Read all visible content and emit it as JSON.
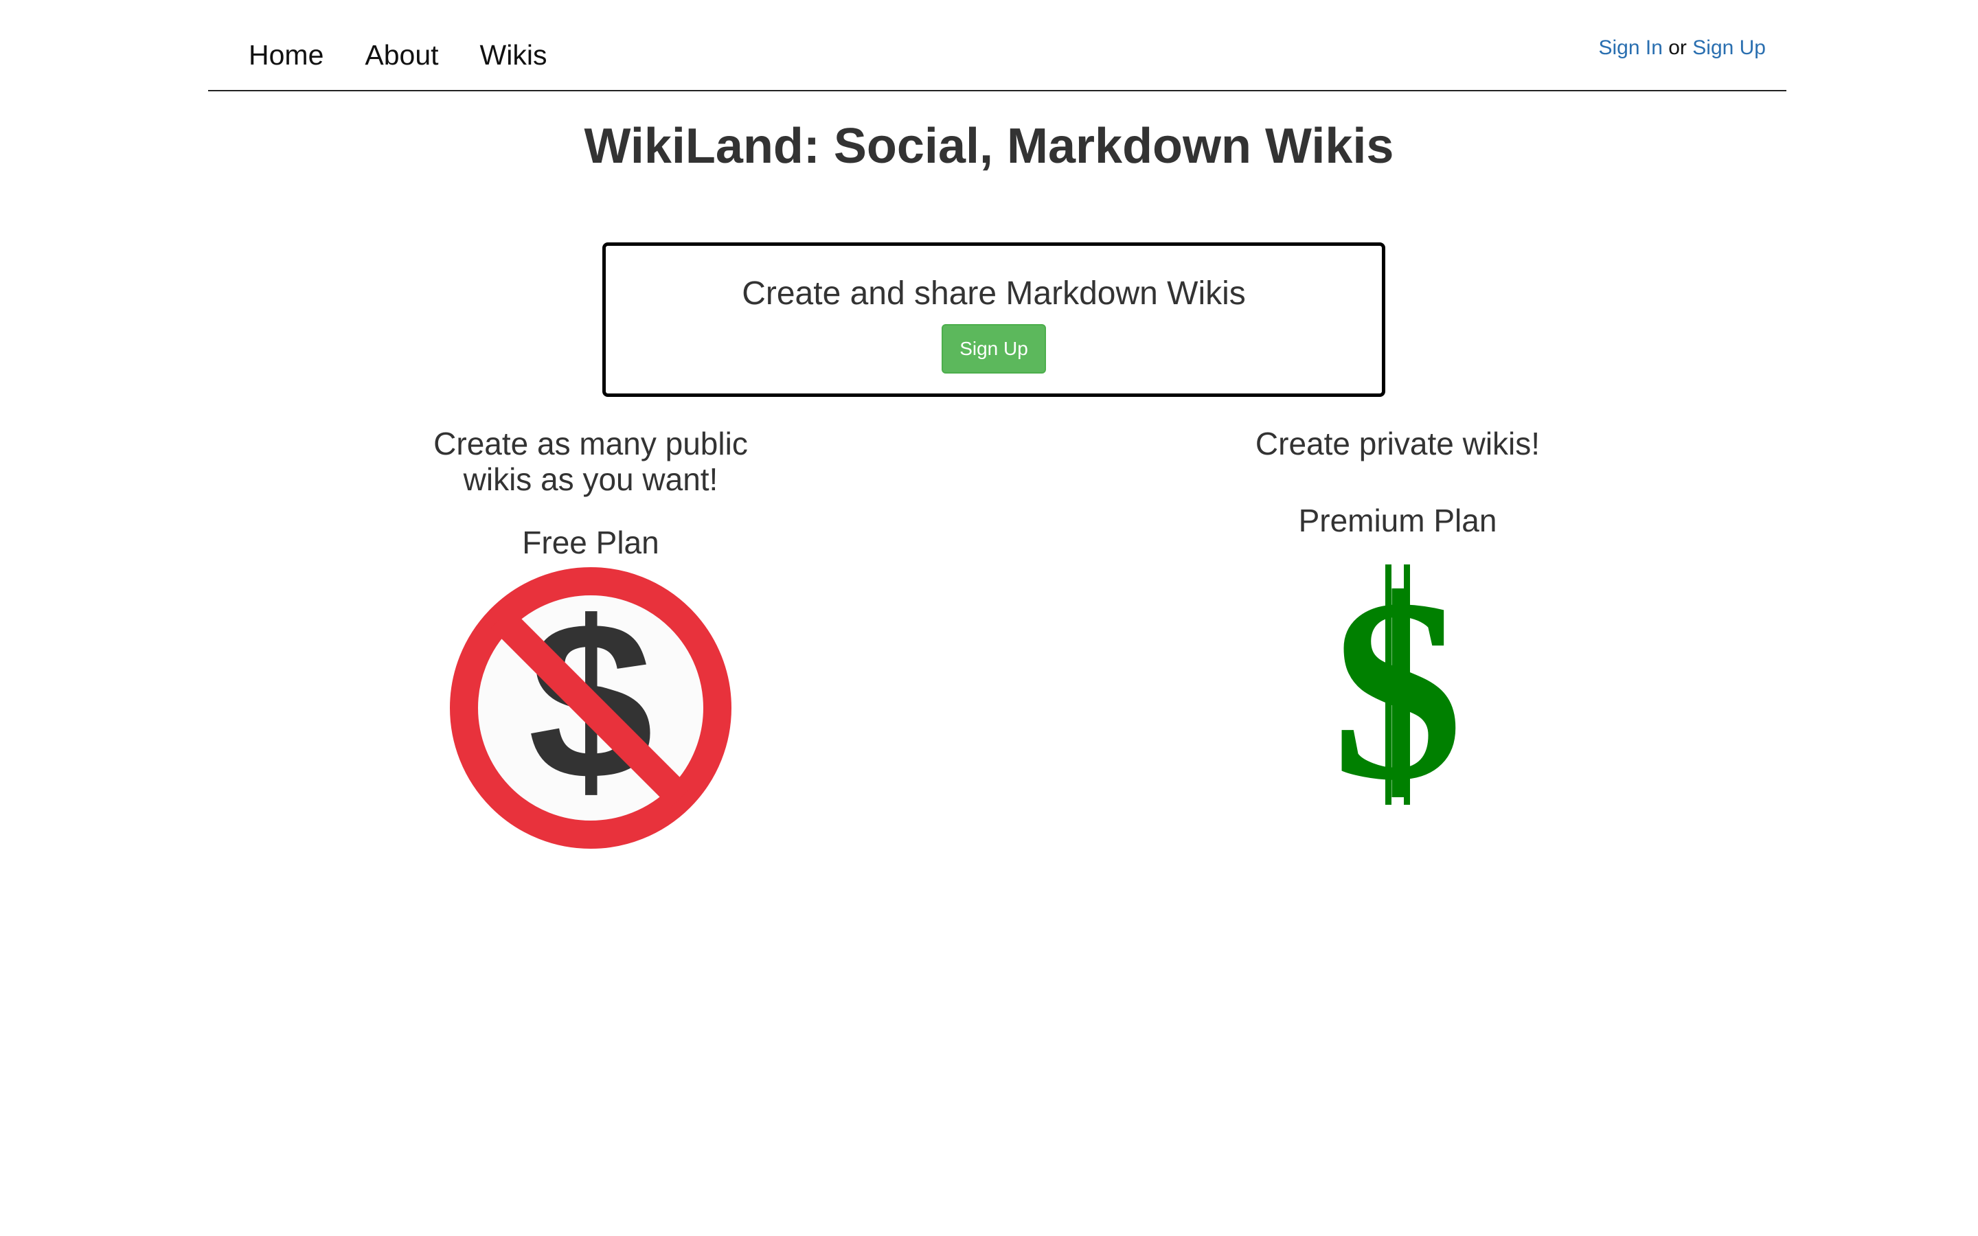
{
  "nav": {
    "items": [
      {
        "label": "Home"
      },
      {
        "label": "About"
      },
      {
        "label": "Wikis"
      }
    ],
    "sign_in": "Sign In",
    "or_text": "or",
    "sign_up": "Sign Up"
  },
  "page": {
    "title": "WikiLand: Social, Markdown Wikis"
  },
  "hero": {
    "title": "Create and share Markdown Wikis",
    "button_label": "Sign Up",
    "button_color": "#5cb85c"
  },
  "plans": [
    {
      "tagline_line1": "Create as many public",
      "tagline_line2": "wikis as you want!",
      "name": "Free Plan",
      "icon": "no-dollar-icon",
      "icon_color": "#e8323c"
    },
    {
      "tagline_line1": "Create private wikis!",
      "tagline_line2": "",
      "name": "Premium Plan",
      "icon": "dollar-icon",
      "icon_color": "#008000"
    }
  ]
}
